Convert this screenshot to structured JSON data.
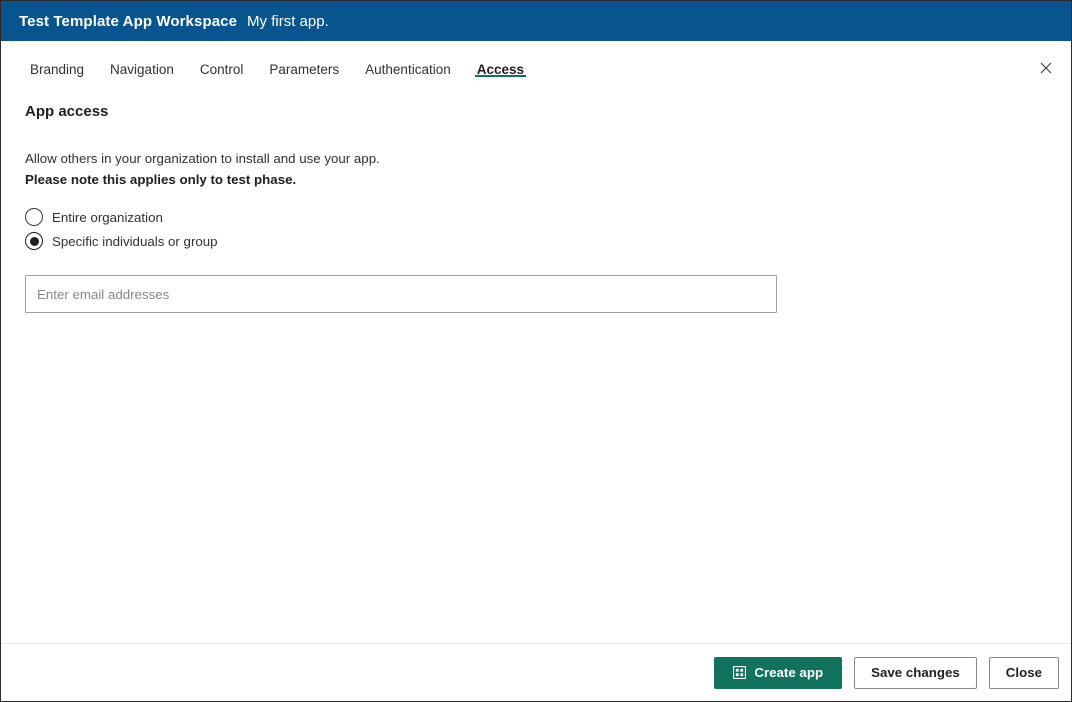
{
  "header": {
    "workspace_name": "Test Template App Workspace",
    "app_name": "My first app.",
    "background": "#08548f",
    "close_icon": "close-icon"
  },
  "tabs": [
    {
      "label": "Branding",
      "active": false
    },
    {
      "label": "Navigation",
      "active": false
    },
    {
      "label": "Control",
      "active": false
    },
    {
      "label": "Parameters",
      "active": false
    },
    {
      "label": "Authentication",
      "active": false
    },
    {
      "label": "Access",
      "active": true
    }
  ],
  "accent": {
    "tab_underline": "#13715f",
    "primary_button": "#11735e"
  },
  "main": {
    "section_title": "App access",
    "description": "Allow others in your organization to install and use your app.",
    "note": "Please note this applies only to test phase.",
    "radio_options": [
      {
        "label": "Entire organization",
        "selected": false
      },
      {
        "label": "Specific individuals or group",
        "selected": true
      }
    ],
    "email_field": {
      "placeholder": "Enter email addresses",
      "value": ""
    }
  },
  "footer": {
    "create_label": "Create app",
    "create_icon": "app-grid-icon",
    "save_label": "Save changes",
    "close_label": "Close"
  }
}
